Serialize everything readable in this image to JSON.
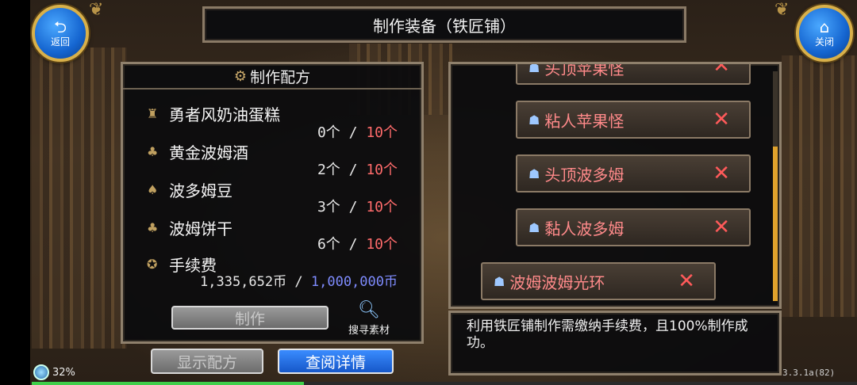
{
  "header": {
    "title": "制作装备（铁匠铺）",
    "back_label": "返回",
    "close_label": "关闭"
  },
  "recipe": {
    "heading": "制作配方",
    "materials": [
      {
        "name": "勇者风奶油蛋糕",
        "have": "0个",
        "sep": "/",
        "need": "10个",
        "icon": "cake-icon"
      },
      {
        "name": "黄金波姆酒",
        "have": "2个",
        "sep": "/",
        "need": "10个",
        "icon": "bottle-icon"
      },
      {
        "name": "波多姆豆",
        "have": "3个",
        "sep": "/",
        "need": "10个",
        "icon": "bean-icon"
      },
      {
        "name": "波姆饼干",
        "have": "6个",
        "sep": "/",
        "need": "10个",
        "icon": "biscuit-icon"
      }
    ],
    "fee": {
      "label": "手续费",
      "have": "1,335,652币",
      "sep": "/",
      "need": "1,000,000币",
      "icon": "coins-icon"
    },
    "make_label": "制作",
    "search_label": "搜寻素材"
  },
  "buttons": {
    "show_recipe": "显示配方",
    "view_details": "查阅详情"
  },
  "equipment_list": [
    {
      "name": "头顶苹果怪",
      "icon": "hat-icon"
    },
    {
      "name": "粘人苹果怪",
      "icon": "hat-icon"
    },
    {
      "name": "头顶波多姆",
      "icon": "hat-icon"
    },
    {
      "name": "黏人波多姆",
      "icon": "hat-icon"
    },
    {
      "name": "波姆波姆光环",
      "icon": "hat-icon"
    }
  ],
  "description": "利用铁匠铺制作需缴纳手续费，且100%制作成功。",
  "status": {
    "battery": "32%",
    "version": "3.3.1a(82)",
    "progress_fraction": 0.33
  },
  "colors": {
    "shortage": "#ff6b6b",
    "fee_need": "#7f8cff",
    "accent_blue": "#1e6fe0",
    "frame": "#8f806c"
  }
}
